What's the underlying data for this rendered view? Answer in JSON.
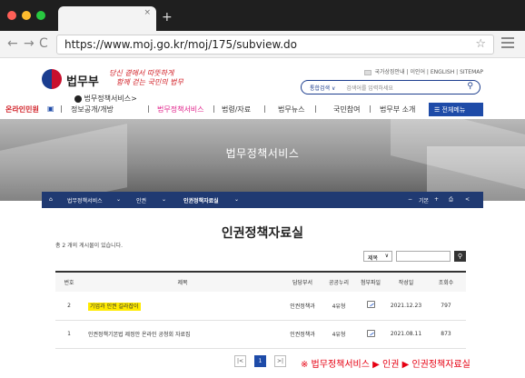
{
  "browser": {
    "url": "https://www.moj.go.kr/moj/175/subview.do",
    "tab_close": "×",
    "new_tab": "+",
    "back": "←",
    "forward": "→",
    "reload": "C",
    "bookmark": "☆"
  },
  "header": {
    "logo_text": "법무부",
    "slogan_line1": "당신 곁에서 따뜻하게",
    "slogan_line2": "함께 걷는 국민의 법무",
    "util_links": [
      "국가상징안내",
      "이인어",
      "ENGLISH",
      "SITEMAP"
    ],
    "search_scope": "통합검색",
    "search_placeholder": "검색어를 입력하세요",
    "site_label": "법무정책서비스"
  },
  "gnb": {
    "items": [
      "온라인민원",
      "정보공개/개방",
      "법무정책서비스",
      "법령/자료",
      "법무뉴스",
      "국민참여",
      "법무부 소개"
    ],
    "all_menu": "전체메뉴"
  },
  "banner": {
    "title": "법무정책서비스",
    "crumbs": [
      "법무정책서비스",
      "인권",
      "인권정책자료실"
    ],
    "tools": [
      "−",
      "기본",
      "+"
    ]
  },
  "content": {
    "page_title": "인권정책자료실",
    "total": "총 2 개의 게시물이 있습니다.",
    "search_select": "제목",
    "columns": [
      "번호",
      "제목",
      "담당부서",
      "공공누리",
      "첨부파일",
      "작성일",
      "조회수"
    ],
    "rows": [
      {
        "no": "2",
        "title": "기업과 인권 길라잡이",
        "dept": "인권정책과",
        "license": "4유형",
        "date": "2021.12.23",
        "views": "797"
      },
      {
        "no": "1",
        "title": "인권정책기본법 제정안 온라인 공청회 자료집",
        "dept": "인권정책과",
        "license": "4유형",
        "date": "2021.08.11",
        "views": "873"
      }
    ]
  },
  "pagination": {
    "prev": "|<",
    "current": "1",
    "next": ">|"
  },
  "note": "※ 법무정책서비스 ▶ 인권 ▶ 인권정책자료실",
  "colors": {
    "brand_blue": "#1e4ba8",
    "nav_dark": "#203a72",
    "highlight": "#ffea00",
    "note_red": "#e60012"
  }
}
